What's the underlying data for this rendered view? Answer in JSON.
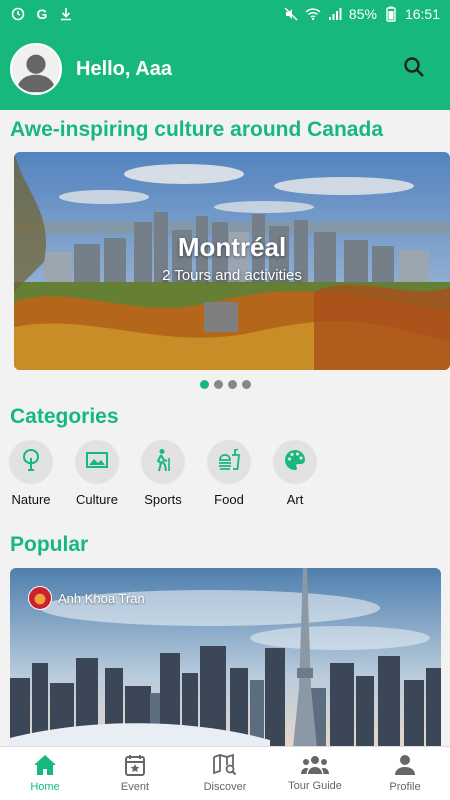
{
  "status_bar": {
    "battery": "85%",
    "time": "16:51"
  },
  "header": {
    "greeting": "Hello, Aaa"
  },
  "featured": {
    "title": "Awe-inspiring culture around Canada",
    "slide": {
      "city": "Montréal",
      "subtitle": "2 Tours and activities"
    },
    "dots_total": 4,
    "active_dot": 1
  },
  "categories": {
    "title": "Categories",
    "items": [
      {
        "label": "Nature",
        "icon": "tree-icon"
      },
      {
        "label": "Culture",
        "icon": "landscape-icon"
      },
      {
        "label": "Sports",
        "icon": "hiking-icon"
      },
      {
        "label": "Food",
        "icon": "fastfood-icon"
      },
      {
        "label": "Art",
        "icon": "palette-icon"
      }
    ]
  },
  "popular": {
    "title": "Popular",
    "author": "Anh Khoa Tran"
  },
  "bottom_nav": {
    "items": [
      {
        "label": "Home",
        "icon": "home-icon",
        "active": true
      },
      {
        "label": "Event",
        "icon": "calendar-star-icon",
        "active": false
      },
      {
        "label": "Discover",
        "icon": "map-search-icon",
        "active": false
      },
      {
        "label": "Tour Guide",
        "icon": "people-icon",
        "active": false
      },
      {
        "label": "Profile",
        "icon": "person-icon",
        "active": false
      }
    ]
  },
  "colors": {
    "primary": "#17b87c"
  }
}
